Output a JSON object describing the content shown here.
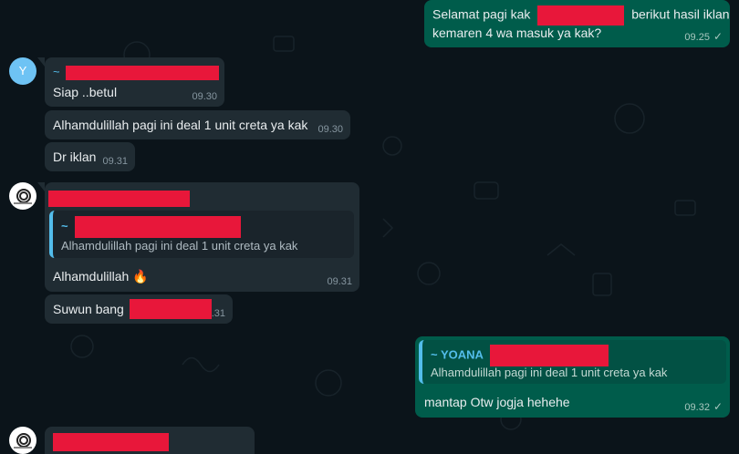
{
  "messages": {
    "m1": {
      "text_before": "Selamat pagi kak",
      "text_after": "berikut hasil iklan",
      "line2": "kemaren 4 wa masuk ya kak?",
      "time": "09.25",
      "check": "✓"
    },
    "m2": {
      "avatar_letter": "Y",
      "sender_prefix": "~",
      "text": "Siap ..betul",
      "time": "09.30"
    },
    "m3": {
      "text": "Alhamdulillah pagi ini deal 1 unit creta ya kak",
      "time": "09.30"
    },
    "m4": {
      "text": "Dr iklan",
      "time": "09.31"
    },
    "m5": {
      "quote_prefix": "~",
      "quote_text": "Alhamdulillah pagi ini deal 1 unit creta ya kak",
      "text": "Alhamdulillah",
      "emoji": "🔥",
      "time": "09.31"
    },
    "m6": {
      "text": "Suwun bang",
      "time_fragment": ".31"
    },
    "m7": {
      "quote_name": "~ YOANA",
      "quote_text": "Alhamdulillah pagi ini deal 1 unit creta ya kak",
      "text": "mantap Otw jogja hehehe",
      "time": "09.32",
      "check": "✓"
    }
  },
  "colors": {
    "background": "#0b141a",
    "incoming": "#202c33",
    "outgoing": "#005c4b",
    "accent": "#53bdeb",
    "redaction": "#e8173a"
  }
}
